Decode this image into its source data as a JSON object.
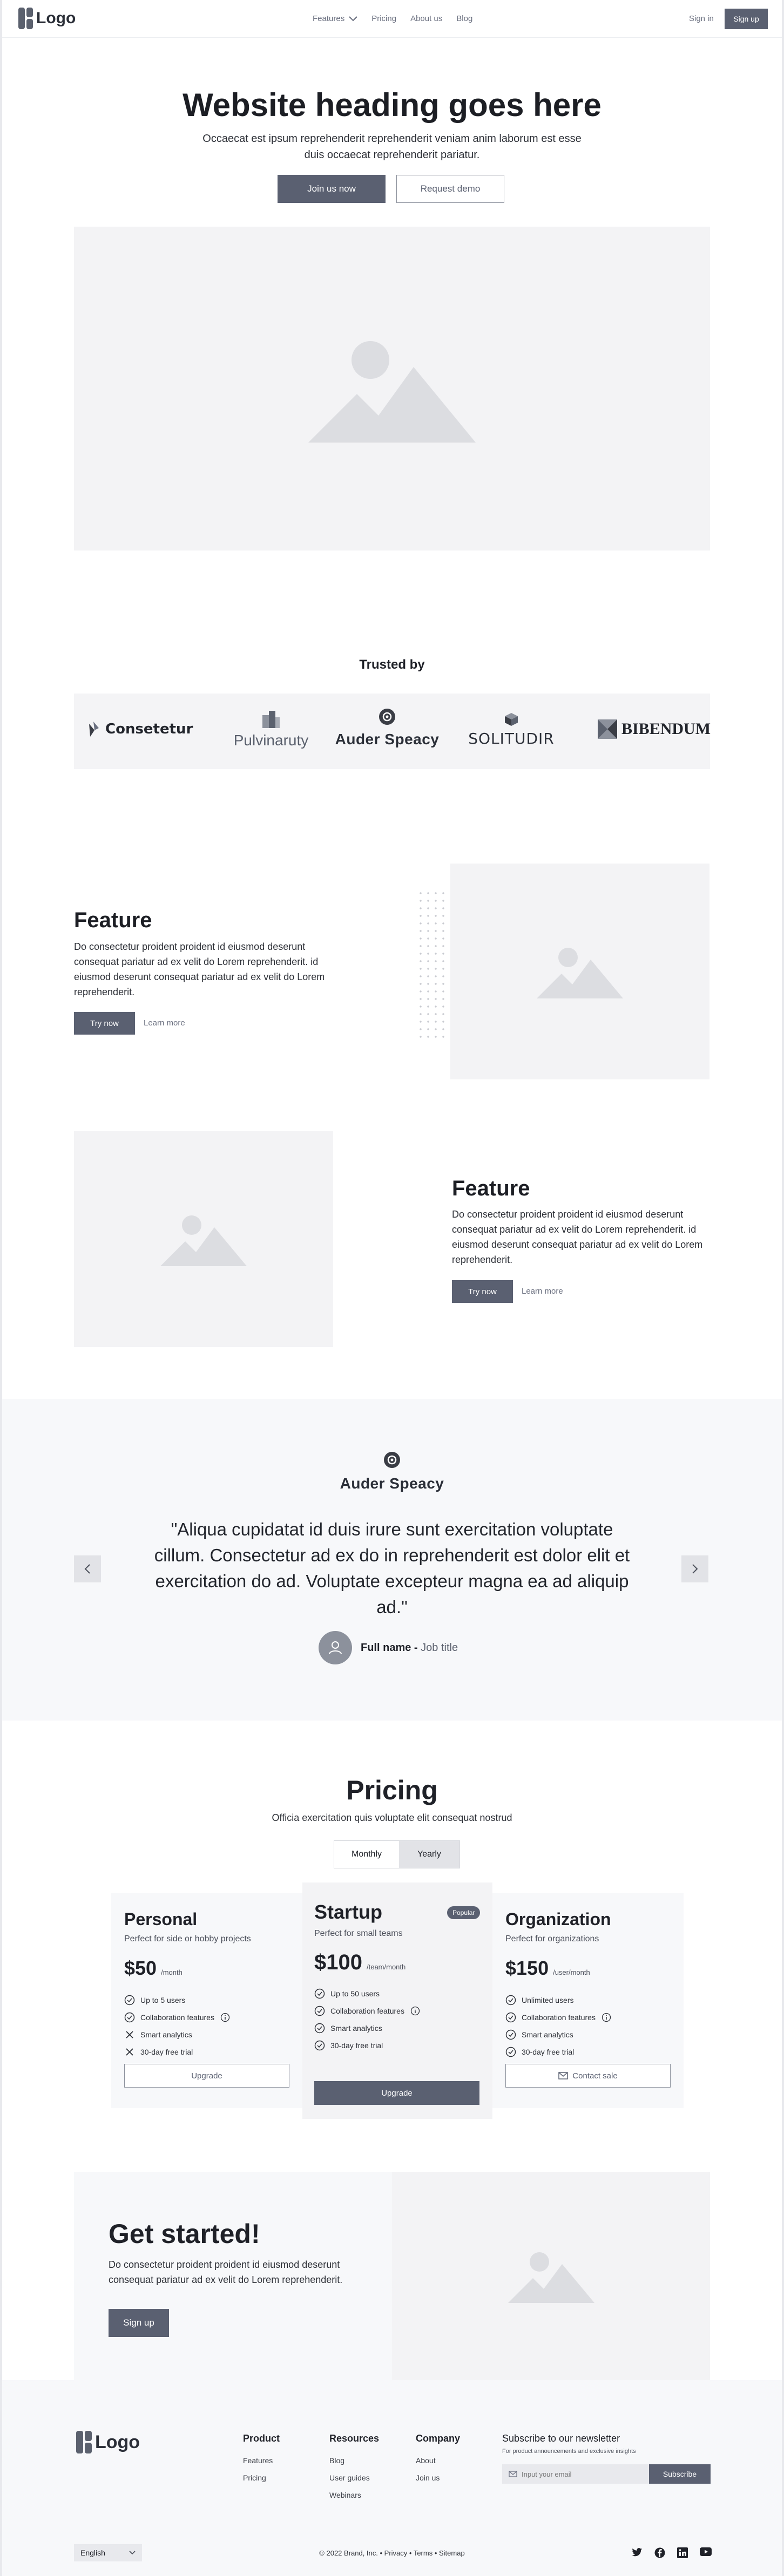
{
  "nav": {
    "logo": "Logo",
    "links": [
      {
        "label": "Features",
        "dropdown": true
      },
      {
        "label": "Pricing"
      },
      {
        "label": "About us"
      },
      {
        "label": "Blog"
      }
    ],
    "signin": "Sign in",
    "signup": "Sign up"
  },
  "hero": {
    "title": "Website heading goes here",
    "subtitle": "Occaecat est ipsum reprehenderit reprehenderit veniam anim laborum est esse duis occaecat reprehenderit pariatur.",
    "primary": "Join us now",
    "secondary": "Request demo"
  },
  "trusted": {
    "title": "Trusted by",
    "logos": [
      "Consetetur",
      "Pulvinaruty",
      "Auder Speacy",
      "SOLITUDIR",
      "BIBENDUM"
    ]
  },
  "features": [
    {
      "title": "Feature",
      "desc": "Do consectetur proident proident id eiusmod deserunt consequat pariatur ad ex velit do Lorem reprehenderit. id eiusmod deserunt consequat pariatur ad ex velit do Lorem reprehenderit.",
      "cta": "Try now",
      "link": "Learn more"
    },
    {
      "title": "Feature",
      "desc": "Do consectetur proident proident id eiusmod deserunt consequat pariatur ad ex velit do Lorem reprehenderit. id eiusmod deserunt consequat pariatur ad ex velit do Lorem reprehenderit.",
      "cta": "Try now",
      "link": "Learn more"
    }
  ],
  "testimonial": {
    "brand": "Auder Speacy",
    "quote": "\"Aliqua cupidatat id duis irure sunt exercitation voluptate cillum. Consectetur ad ex do in reprehenderit est dolor elit et exercitation do ad. Voluptate excepteur magna ea ad aliquip ad.\"",
    "name": "Full name",
    "separator": " - ",
    "job": "Job title"
  },
  "pricing": {
    "title": "Pricing",
    "subtitle": "Officia exercitation quis voluptate elit consequat nostrud",
    "toggle": [
      "Monthly",
      "Yearly"
    ],
    "plans": [
      {
        "name": "Personal",
        "sub": "Perfect for side or hobby projects",
        "price": "$50",
        "period": "/month",
        "features": [
          {
            "label": "Up to 5 users",
            "icon": "check-icon"
          },
          {
            "label": "Collaboration features",
            "icon": "check-icon",
            "info": true
          },
          {
            "label": "Smart analytics",
            "icon": "x-icon"
          },
          {
            "label": "30-day free trial",
            "icon": "x-icon"
          }
        ],
        "cta": "Upgrade"
      },
      {
        "name": "Startup",
        "sub": "Perfect for small teams",
        "badge": "Popular",
        "price": "$100",
        "period": "/team/month",
        "features": [
          {
            "label": "Up to 50 users",
            "icon": "check-icon"
          },
          {
            "label": "Collaboration features",
            "icon": "check-icon",
            "info": true
          },
          {
            "label": "Smart analytics",
            "icon": "check-icon"
          },
          {
            "label": "30-day free trial",
            "icon": "check-icon"
          }
        ],
        "cta": "Upgrade"
      },
      {
        "name": "Organization",
        "sub": "Perfect for organizations",
        "price": "$150",
        "period": "/user/month",
        "features": [
          {
            "label": "Unlimited users",
            "icon": "check-icon"
          },
          {
            "label": "Collaboration features",
            "icon": "check-icon",
            "info": true
          },
          {
            "label": "Smart analytics",
            "icon": "check-icon"
          },
          {
            "label": "30-day free trial",
            "icon": "check-icon"
          }
        ],
        "cta": "Contact sale"
      }
    ]
  },
  "cta": {
    "title": "Get started!",
    "desc": "Do consectetur proident proident id eiusmod deserunt consequat pariatur ad ex velit do Lorem reprehenderit.",
    "button": "Sign up"
  },
  "footer": {
    "logo": "Logo",
    "columns": [
      {
        "title": "Product",
        "items": [
          "Features",
          "Pricing"
        ]
      },
      {
        "title": "Resources",
        "items": [
          "Blog",
          "User guides",
          "Webinars"
        ]
      },
      {
        "title": "Company",
        "items": [
          "About",
          "Join us"
        ]
      }
    ],
    "newsletter": {
      "title": "Subscribe to our newsletter",
      "sub": "For product announcements and exclusive insights",
      "placeholder": "Input your email",
      "button": "Subscribe"
    },
    "language": "English",
    "copyright": "© 2022 Brand, Inc. • Privacy • Terms • Sitemap",
    "social": [
      "twitter-icon",
      "facebook-icon",
      "linkedin-icon",
      "youtube-icon"
    ]
  },
  "colors": {
    "accent": "#5a6071",
    "placeholder": "#f3f3f5",
    "section": "#f7f8fa"
  }
}
